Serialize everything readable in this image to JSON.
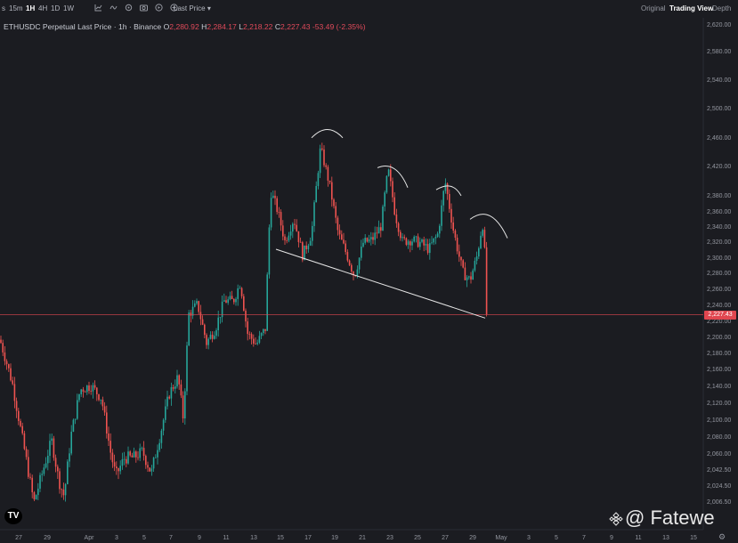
{
  "toolbar": {
    "timeframes": [
      {
        "label": "s",
        "active": false
      },
      {
        "label": "15m",
        "active": false
      },
      {
        "label": "1H",
        "active": true
      },
      {
        "label": "4H",
        "active": false
      },
      {
        "label": "1D",
        "active": false
      },
      {
        "label": "1W",
        "active": false
      }
    ],
    "icons": [
      "chart-type-icon",
      "indicators-icon",
      "settings-icon",
      "camera-icon",
      "replay-icon",
      "add-icon"
    ],
    "price_source": "Last Price",
    "views": [
      {
        "label": "Original",
        "active": false
      },
      {
        "label": "Trading View",
        "active": true
      },
      {
        "label": "Depth",
        "active": false
      }
    ]
  },
  "legend": {
    "symbol": "ETHUSDC Perpetual Last Price · 1h · Binance",
    "open_label": "O",
    "open": "2,280.92",
    "high_label": "H",
    "high": "2,284.17",
    "low_label": "L",
    "low": "2,218.22",
    "close_label": "C",
    "close": "2,227.43",
    "change": "-53.49 (-2.35%)"
  },
  "current_price": "2,227.43",
  "watermark": "@ Fatewe",
  "colors": {
    "up": "#26a69a",
    "down": "#ef5350",
    "price_line": "#e0464f",
    "annotation": "#e6e6e6",
    "background": "#1b1c21"
  },
  "chart_data": {
    "type": "candlestick",
    "y_ticks": [
      2620,
      2580,
      2540,
      2500,
      2460,
      2420,
      2380,
      2360,
      2340,
      2320,
      2300,
      2280,
      2260,
      2240,
      2220,
      2200,
      2180,
      2160,
      2140,
      2120,
      2100,
      2080,
      2060,
      2042.5,
      2024.5,
      2006.5
    ],
    "y_tick_labels": [
      "2,620.00",
      "2,580.00",
      "2,540.00",
      "2,500.00",
      "2,460.00",
      "2,420.00",
      "2,380.00",
      "2,360.00",
      "2,340.00",
      "2,320.00",
      "2,300.00",
      "2,280.00",
      "2,260.00",
      "2,240.00",
      "2,220.00",
      "2,200.00",
      "2,180.00",
      "2,160.00",
      "2,140.00",
      "2,120.00",
      "2,100.00",
      "2,080.00",
      "2,060.00",
      "2,042.50",
      "2,024.50",
      "2,006.50"
    ],
    "x_ticks": [
      "27",
      "29",
      "Apr",
      "3",
      "5",
      "7",
      "9",
      "11",
      "13",
      "15",
      "17",
      "19",
      "21",
      "23",
      "25",
      "27",
      "29",
      "May",
      "3",
      "5",
      "7",
      "9",
      "11",
      "13",
      "15"
    ],
    "price_path": [
      [
        0,
        2196
      ],
      [
        14,
        2142
      ],
      [
        26,
        2072
      ],
      [
        38,
        2005
      ],
      [
        48,
        2040
      ],
      [
        58,
        2075
      ],
      [
        66,
        2030
      ],
      [
        72,
        2012
      ],
      [
        80,
        2082
      ],
      [
        90,
        2135
      ],
      [
        102,
        2140
      ],
      [
        114,
        2125
      ],
      [
        124,
        2062
      ],
      [
        130,
        2035
      ],
      [
        140,
        2055
      ],
      [
        150,
        2055
      ],
      [
        160,
        2062
      ],
      [
        170,
        2038
      ],
      [
        180,
        2082
      ],
      [
        190,
        2130
      ],
      [
        200,
        2150
      ],
      [
        206,
        2100
      ],
      [
        212,
        2228
      ],
      [
        222,
        2240
      ],
      [
        232,
        2192
      ],
      [
        242,
        2210
      ],
      [
        252,
        2245
      ],
      [
        262,
        2244
      ],
      [
        270,
        2268
      ],
      [
        278,
        2204
      ],
      [
        288,
        2190
      ],
      [
        298,
        2210
      ],
      [
        304,
        2385
      ],
      [
        312,
        2360
      ],
      [
        320,
        2320
      ],
      [
        330,
        2350
      ],
      [
        340,
        2302
      ],
      [
        350,
        2330
      ],
      [
        360,
        2445
      ],
      [
        370,
        2395
      ],
      [
        380,
        2330
      ],
      [
        390,
        2302
      ],
      [
        398,
        2275
      ],
      [
        408,
        2318
      ],
      [
        418,
        2322
      ],
      [
        428,
        2340
      ],
      [
        436,
        2415
      ],
      [
        444,
        2355
      ],
      [
        452,
        2320
      ],
      [
        462,
        2322
      ],
      [
        472,
        2318
      ],
      [
        482,
        2310
      ],
      [
        492,
        2330
      ],
      [
        500,
        2398
      ],
      [
        510,
        2330
      ],
      [
        520,
        2280
      ],
      [
        528,
        2270
      ],
      [
        536,
        2302
      ],
      [
        542,
        2345
      ],
      [
        546,
        2280
      ],
      [
        548,
        2227.43
      ]
    ],
    "seed": 7,
    "current_price": 2227.43,
    "annotations": {
      "neckline": [
        [
          310,
          2310
        ],
        [
          545,
          2223
        ]
      ],
      "arcs": [
        [
          [
            350,
            2459
          ],
          [
            368,
            2472
          ],
          [
            385,
            2459
          ]
        ],
        [
          [
            424,
            2417
          ],
          [
            445,
            2418
          ],
          [
            458,
            2390
          ]
        ],
        [
          [
            490,
            2387
          ],
          [
            508,
            2391
          ],
          [
            518,
            2379
          ]
        ],
        [
          [
            528,
            2349
          ],
          [
            552,
            2361
          ],
          [
            570,
            2324
          ]
        ]
      ]
    }
  }
}
